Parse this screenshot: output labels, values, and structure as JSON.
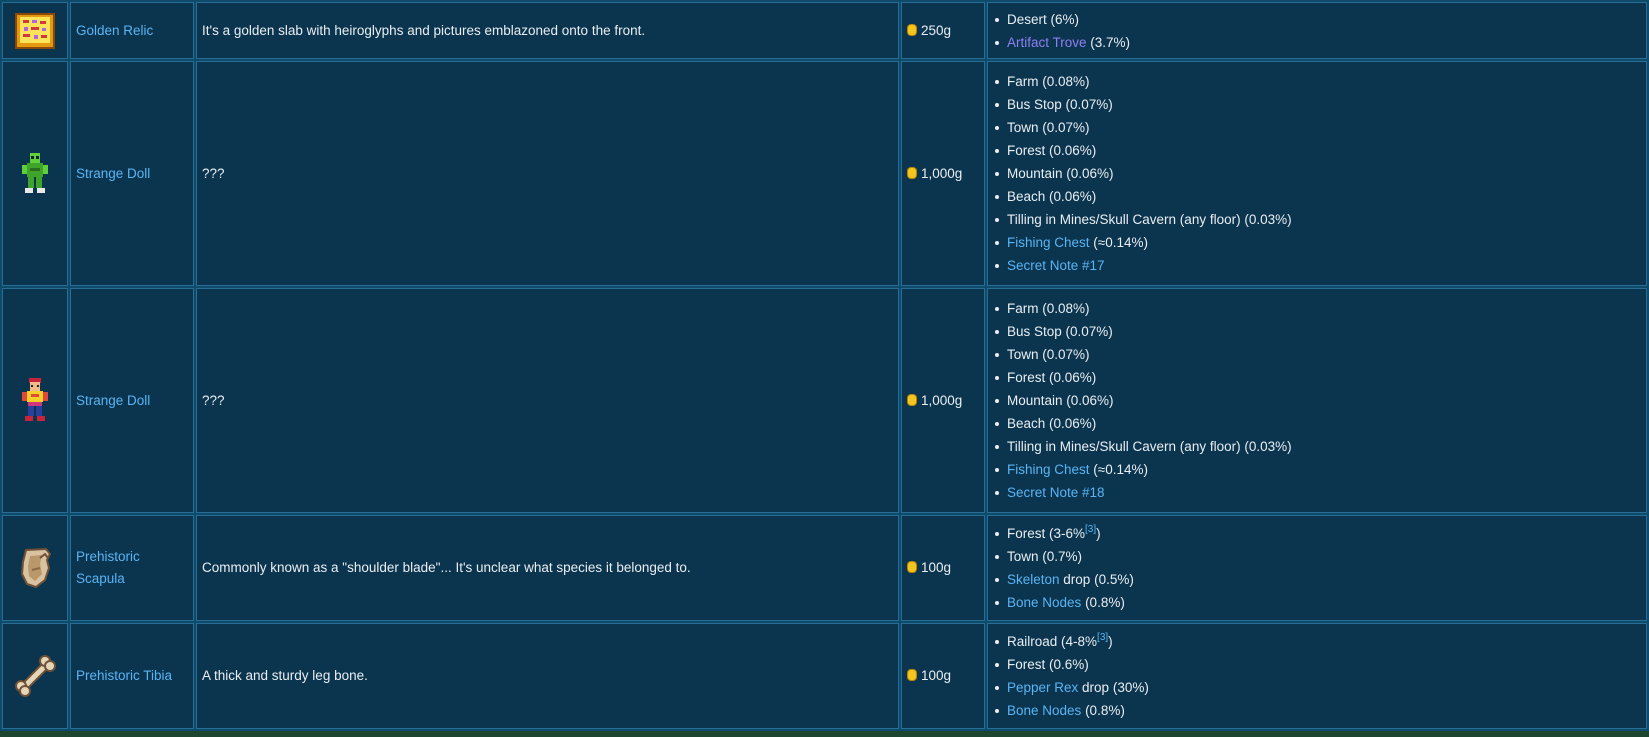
{
  "rows": [
    {
      "icon": "golden-relic-icon",
      "name": "Golden Relic",
      "description": "It's a golden slab with heiroglyphs and pictures emblazoned onto the front.",
      "price": "250g",
      "locations": [
        {
          "text": "Desert (6%)"
        },
        {
          "link": "Artifact Trove",
          "suffix": " (3.7%)",
          "visited": true
        }
      ]
    },
    {
      "icon": "strange-doll-green-icon",
      "name": "Strange Doll",
      "description": "???",
      "price": "1,000g",
      "locations": [
        {
          "text": "Farm (0.08%)"
        },
        {
          "text": "Bus Stop (0.07%)"
        },
        {
          "text": "Town (0.07%)"
        },
        {
          "text": "Forest (0.06%)"
        },
        {
          "text": "Mountain (0.06%)"
        },
        {
          "text": "Beach (0.06%)"
        },
        {
          "text": "Tilling in Mines/Skull Cavern (any floor) (0.03%)"
        },
        {
          "link": "Fishing Chest",
          "suffix": " (≈0.14%)"
        },
        {
          "link": "Secret Note #17"
        }
      ]
    },
    {
      "icon": "strange-doll-yellow-icon",
      "name": "Strange Doll",
      "description": "???",
      "price": "1,000g",
      "locations": [
        {
          "text": "Farm (0.08%)"
        },
        {
          "text": "Bus Stop (0.07%)"
        },
        {
          "text": "Town (0.07%)"
        },
        {
          "text": "Forest (0.06%)"
        },
        {
          "text": "Mountain (0.06%)"
        },
        {
          "text": "Beach (0.06%)"
        },
        {
          "text": "Tilling in Mines/Skull Cavern (any floor) (0.03%)"
        },
        {
          "link": "Fishing Chest",
          "suffix": " (≈0.14%)"
        },
        {
          "link": "Secret Note #18"
        }
      ]
    },
    {
      "icon": "prehistoric-scapula-icon",
      "name": "Prehistoric Scapula",
      "description": "Commonly known as a \"shoulder blade\"... It's unclear what species it belonged to.",
      "price": "100g",
      "locations": [
        {
          "text": "Forest (3-6%",
          "sup": "[3]",
          "after": ")"
        },
        {
          "text": "Town (0.7%)"
        },
        {
          "link": "Skeleton",
          "suffix": " drop (0.5%)"
        },
        {
          "link": "Bone Nodes",
          "suffix": " (0.8%)"
        }
      ]
    },
    {
      "icon": "prehistoric-tibia-icon",
      "name": "Prehistoric Tibia",
      "description": "A thick and sturdy leg bone.",
      "price": "100g",
      "locations": [
        {
          "text": "Railroad (4-8%",
          "sup": "[3]",
          "after": ")"
        },
        {
          "text": "Forest (0.6%)"
        },
        {
          "link": "Pepper Rex",
          "suffix": " drop (30%)"
        },
        {
          "link": "Bone Nodes",
          "suffix": " (0.8%)"
        }
      ]
    }
  ]
}
